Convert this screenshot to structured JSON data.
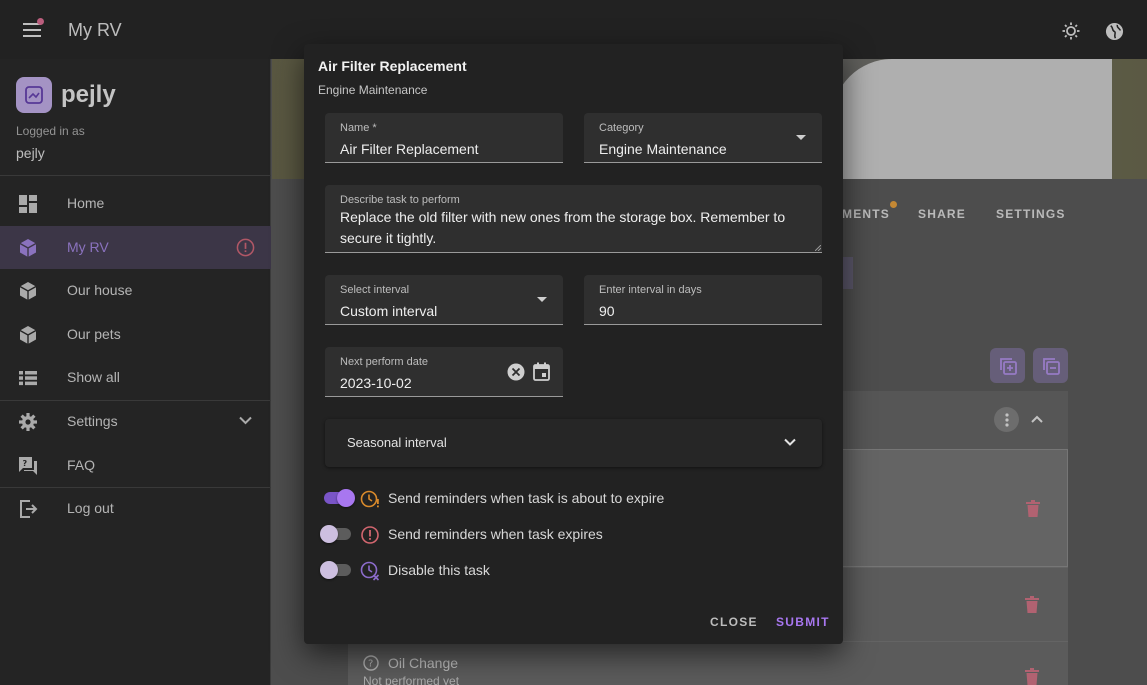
{
  "appbar": {
    "title": "My RV",
    "menu_icon": "menu-icon",
    "theme_icon": "brightness-icon",
    "language_icon": "globe-icon",
    "notification_color": "#e57399"
  },
  "sidebar": {
    "brand": "pejly",
    "logged_in_label": "Logged in as",
    "username": "pejly",
    "items": [
      {
        "label": "Home",
        "icon": "dashboard-icon"
      },
      {
        "label": "My RV",
        "icon": "cube-icon",
        "active": true,
        "alert_icon": "alert-circle-icon"
      },
      {
        "label": "Our house",
        "icon": "cube-icon"
      },
      {
        "label": "Our pets",
        "icon": "cube-icon"
      },
      {
        "label": "Show all",
        "icon": "list-icon"
      },
      {
        "label": "Settings",
        "icon": "gear-icon",
        "expand_icon": "chevron-down-icon"
      },
      {
        "label": "FAQ",
        "icon": "faq-icon"
      },
      {
        "label": "Log out",
        "icon": "logout-icon"
      }
    ]
  },
  "main": {
    "tabs": [
      {
        "label": "MENTS"
      },
      {
        "label": "SHARE"
      },
      {
        "label": "SETTINGS"
      }
    ],
    "task_row": {
      "name": "Oil Change",
      "status": "Not performed yet"
    }
  },
  "dialog": {
    "title": "Air Filter Replacement",
    "subtitle": "Engine Maintenance",
    "name_field": {
      "label": "Name *",
      "value": "Air Filter Replacement"
    },
    "category_field": {
      "label": "Category",
      "value": "Engine Maintenance"
    },
    "description_field": {
      "label": "Describe task to perform",
      "value": "Replace the old filter with new ones from the storage box. Remember to secure it tightly."
    },
    "interval_select": {
      "label": "Select interval",
      "value": "Custom interval"
    },
    "interval_days": {
      "label": "Enter interval in days",
      "value": "90"
    },
    "next_date": {
      "label": "Next perform date",
      "value": "2023-10-02"
    },
    "seasonal": {
      "label": "Seasonal interval"
    },
    "toggles": [
      {
        "label": "Send reminders when task is about to expire",
        "on": true,
        "icon": "clock-alert-icon",
        "color": "#d98a2b"
      },
      {
        "label": "Send reminders when task expires",
        "on": false,
        "icon": "alert-circle-icon",
        "color": "#d2666f"
      },
      {
        "label": "Disable this task",
        "on": false,
        "icon": "clock-off-icon",
        "color": "#8c6ccc"
      }
    ],
    "close_label": "CLOSE",
    "submit_label": "SUBMIT"
  },
  "colors": {
    "accent": "#a877f0",
    "danger": "#e57399",
    "warning": "#f0a640"
  }
}
